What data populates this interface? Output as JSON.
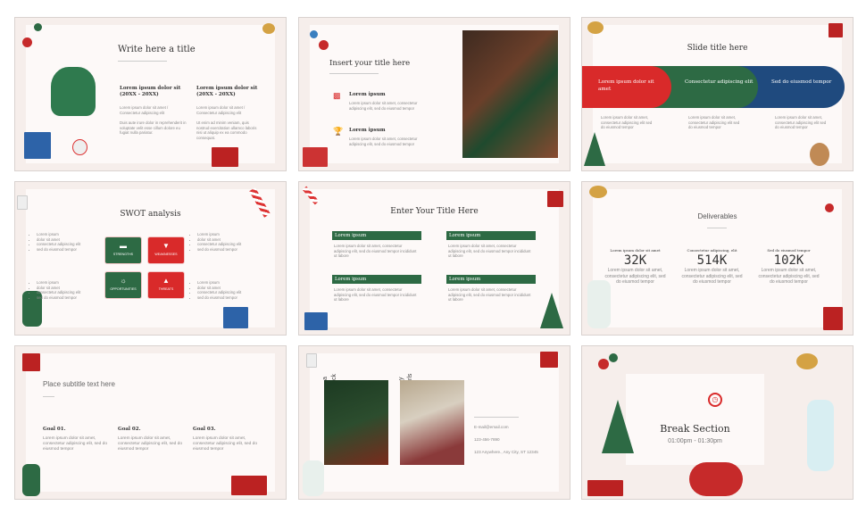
{
  "slide1": {
    "title": "Write here a title",
    "cols": [
      {
        "heading": "Lorem ipsum dolor sit (20XX - 20XX)",
        "sub": "Lorem ipsum dolor sit amet / Consectetur adipiscing elit",
        "body": "Duis aute irure dolor in reprehenderit in voluptate velit esse cillum dolore eu fugiat nulla pariatur."
      },
      {
        "heading": "Lorem ipsum dolor sit (20XX - 20XX)",
        "sub": "Lorem ipsum dolor sit amet / Consectetur adipiscing elit",
        "body": "Ut enim ad minim veniam, quis nostrud exercitation ullamco laboris nisi ut aliquip ex ea commodo consequat."
      }
    ]
  },
  "slide2": {
    "title": "Insert your title here",
    "items": [
      {
        "icon": "chart-icon",
        "heading": "Lorem ipsum",
        "body": "Lorem ipsum dolor sit amet, consectetur adipiscing elit, sed do eiusmod tempor"
      },
      {
        "icon": "trophy-icon",
        "heading": "Lorem ipsum",
        "body": "Lorem ipsum dolor sit amet, consectetur adipiscing elit, sed do eiusmod tempor"
      }
    ]
  },
  "slide3": {
    "title": "Slide title here",
    "bands": [
      {
        "label": "Lorem ipsum dolor sit amet",
        "color": "#d92a2a",
        "body": "Lorem ipsum dolor sit amet, consectetur adipiscing elit sed do eiusmod tempor"
      },
      {
        "label": "Consectetur adipiscing elit",
        "color": "#2d6a44",
        "body": "Lorem ipsum dolor sit amet, consectetur adipiscing elit sed do eiusmod tempor"
      },
      {
        "label": "Sed do eiusmod tempor",
        "color": "#1f4a7e",
        "body": "Lorem ipsum dolor sit amet, consectetur adipiscing elit sed do eiusmod tempor"
      }
    ]
  },
  "slide4": {
    "title": "SWOT analysis",
    "boxes": [
      {
        "label": "STRENGTHS",
        "icon": "dumbbell-icon",
        "color": "#2d6a44"
      },
      {
        "label": "WEAKNESSES",
        "icon": "thumbs-down-icon",
        "color": "#d92a2a"
      },
      {
        "label": "OPPORTUNITIES",
        "icon": "lightbulb-icon",
        "color": "#2d6a44"
      },
      {
        "label": "THREATS",
        "icon": "warning-icon",
        "color": "#d92a2a"
      }
    ],
    "bullets": [
      "Lorem ipsum",
      "dolor sit amet",
      "consectetur adipiscing elit",
      "sed do eiusmod tempor"
    ]
  },
  "slide5": {
    "title": "Enter Your Title Here",
    "blocks": [
      {
        "heading": "Lorem ipsum",
        "body": "Lorem ipsum dolor sit amet, consectetur adipiscing elit, sed do eiusmod tempor incididunt ut labore"
      },
      {
        "heading": "Lorem ipsum",
        "body": "Lorem ipsum dolor sit amet, consectetur adipiscing elit, sed do eiusmod tempor incididunt ut labore"
      },
      {
        "heading": "Lorem ipsum",
        "body": "Lorem ipsum dolor sit amet, consectetur adipiscing elit, sed do eiusmod tempor incididunt ut labore"
      },
      {
        "heading": "Lorem ipsum",
        "body": "Lorem ipsum dolor sit amet, consectetur adipiscing elit, sed do eiusmod tempor incididunt ut labore"
      }
    ]
  },
  "slide6": {
    "title": "Deliverables",
    "stats": [
      {
        "label": "Lorem ipsum dolor sit amet",
        "value": "32K",
        "body": "Lorem ipsum dolor sit amet, consectetur adipiscing elit, sed do eiusmod tempor"
      },
      {
        "label": "Consectetur adipiscing, elit",
        "value": "514K",
        "body": "Lorem ipsum dolor sit amet, consectetur adipiscing elit, sed do eiusmod tempor"
      },
      {
        "label": "Sed do eiusmod tempor",
        "value": "102K",
        "body": "Lorem ipsum dolor sit amet, consectetur adipiscing elit, sed do eiusmod tempor"
      }
    ]
  },
  "slide7": {
    "title": "Place subtitle text here",
    "goals": [
      {
        "heading": "Goal 01.",
        "body": "Lorem ipsum dolor sit amet, consectetur adipiscing elit, sed do eiusmod tempor"
      },
      {
        "heading": "Goal 02.",
        "body": "Lorem ipsum dolor sit amet, consectetur adipiscing elit, sed do eiusmod tempor"
      },
      {
        "heading": "Goal 03.",
        "body": "Lorem ipsum dolor sit amet, consectetur adipiscing elit, sed do eiusmod tempor"
      }
    ]
  },
  "slide8": {
    "names": [
      {
        "a": "a",
        "b": "ck"
      },
      {
        "a": "y",
        "b": "rls"
      }
    ],
    "email": "E-mail@email.com",
    "phone": "123-456-7890",
    "address": "123 Anywhere., Any City, ST 12345"
  },
  "slide9": {
    "title": "Break Section",
    "time": "01:00pm - 01:30pm",
    "icon": "stopwatch-icon",
    "accent": "#d92a2a"
  }
}
